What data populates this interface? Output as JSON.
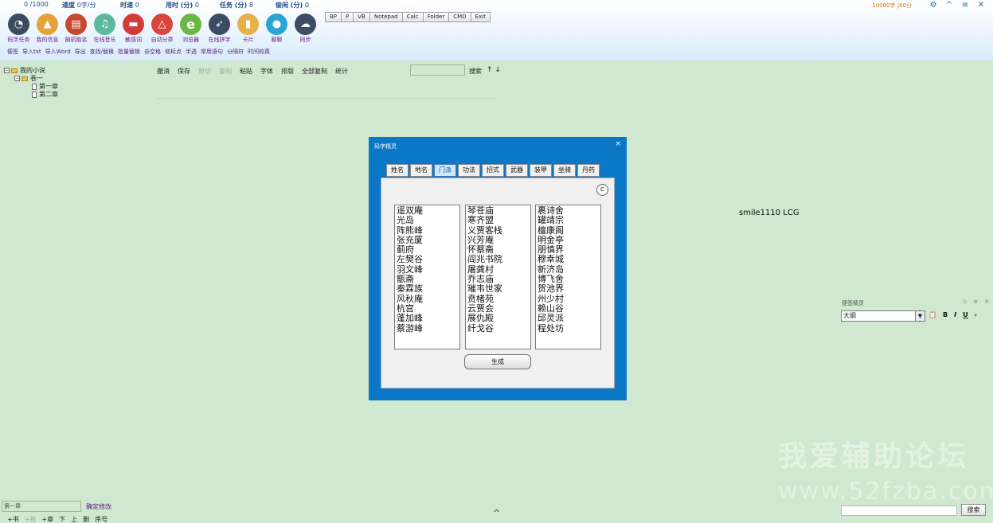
{
  "header": {
    "stats": [
      {
        "key": "",
        "value": "0 /1000"
      },
      {
        "key": "速度",
        "value": "0字/分"
      },
      {
        "key": "时速",
        "value": "0"
      },
      {
        "key": "用时 (分)",
        "value": "0"
      },
      {
        "key": "任务 (分)",
        "value": "8"
      },
      {
        "key": "偷闲 (分)",
        "value": "0"
      }
    ],
    "quick_buttons": [
      "BP",
      "P",
      "VB",
      "Notepad",
      "Calc",
      "Folder",
      "CMD",
      "Exit"
    ],
    "toolbar": [
      {
        "label": "码字任务",
        "icon": "gauge-icon",
        "color": "#3b4a5e"
      },
      {
        "label": "我的信息",
        "icon": "graduation-cap-icon",
        "color": "#e7a23a"
      },
      {
        "label": "随机取名",
        "icon": "notebook-icon",
        "color": "#c8472e"
      },
      {
        "label": "在线音乐",
        "icon": "music-note-icon",
        "color": "#5bb89e"
      },
      {
        "label": "敏感词",
        "icon": "no-entry-icon",
        "color": "#d33b3b"
      },
      {
        "label": "自动分章",
        "icon": "compass-icon",
        "color": "#d8453b"
      },
      {
        "label": "浏览器",
        "icon": "browser-e-icon",
        "color": "#69b843"
      },
      {
        "label": "在线拼字",
        "icon": "rocket-icon",
        "color": "#3c4a63"
      },
      {
        "label": "卡片",
        "icon": "bookmark-icon",
        "color": "#e6b14a"
      },
      {
        "label": "聊聊",
        "icon": "chat-bubble-icon",
        "color": "#2aa5d8"
      },
      {
        "label": "同步",
        "icon": "cloud-icon",
        "color": "#3d4d66"
      }
    ],
    "menu2": [
      "便签",
      "导入txt",
      "导入Word",
      "导出",
      "查找/替换",
      "批量替换",
      "去空格",
      "修标点",
      "半透",
      "常用语句",
      "分隔符",
      "时间较真"
    ],
    "word_goal": "10000字 |60分",
    "window_buttons": [
      "settings-gear-icon",
      "collapse-icon",
      "minimize-icon",
      "close-icon"
    ]
  },
  "tree": {
    "root": "我的小说",
    "volume": "卷一",
    "chapters": [
      "第一章",
      "第二章"
    ]
  },
  "editbar": {
    "items": [
      "撤消",
      "保存",
      "剪切",
      "复制",
      "粘贴",
      "字体",
      "排版",
      "全部复制",
      "统计"
    ],
    "disabled": [
      "剪切",
      "复制"
    ],
    "search_label": "搜索",
    "arrows": "↑ ↓"
  },
  "center_text": "smile1110 LCG",
  "dialog": {
    "title": "码字精灵",
    "tabs": [
      "姓名",
      "地名",
      "门派",
      "功法",
      "招式",
      "武器",
      "装甲",
      "坐骑",
      "丹药"
    ],
    "active_tab": "门派",
    "clear_button": "C",
    "columns": [
      [
        "遥双庵",
        "光岛",
        "阵熊峰",
        "张充厦",
        "蓟府",
        "左樊谷",
        "羽文峰",
        "甑斋",
        "秦霖族",
        "风秋庵",
        "杭宫",
        "蓬加峰",
        "蔡游峰"
      ],
      [
        "琴苍庙",
        "寒齐盟",
        "义贾客栈",
        "兴芳庵",
        "怀蔡斋",
        "阎兆书院",
        "屠龚村",
        "乔志庙",
        "璀韦世家",
        "贲楮苑",
        "云贾会",
        "展仇殿",
        "纤戈谷"
      ],
      [
        "裹诗舍",
        "罐靖宗",
        "檀康阁",
        "明金亭",
        "朋慎界",
        "穆幸城",
        "新济岛",
        "博飞舍",
        "贺池界",
        "州少村",
        "赖山谷",
        "邱灵派",
        "程处坊"
      ]
    ],
    "generate_button": "生成"
  },
  "notes": {
    "title": "便签精灵",
    "selected": "大纲",
    "format_buttons": [
      "📋",
      "B",
      "I",
      "U",
      "›"
    ]
  },
  "watermark": {
    "line1": "我爱辅助论坛",
    "line2": "www.52fzba.com"
  },
  "bottom": {
    "chapter_input": "第一章",
    "confirm": "确定修改",
    "buttons": [
      "+书",
      "+卷",
      "+章",
      "下",
      "上",
      "删",
      "序号"
    ],
    "disabled": [
      "+卷"
    ],
    "caret": "^",
    "search_button": "搜索"
  }
}
